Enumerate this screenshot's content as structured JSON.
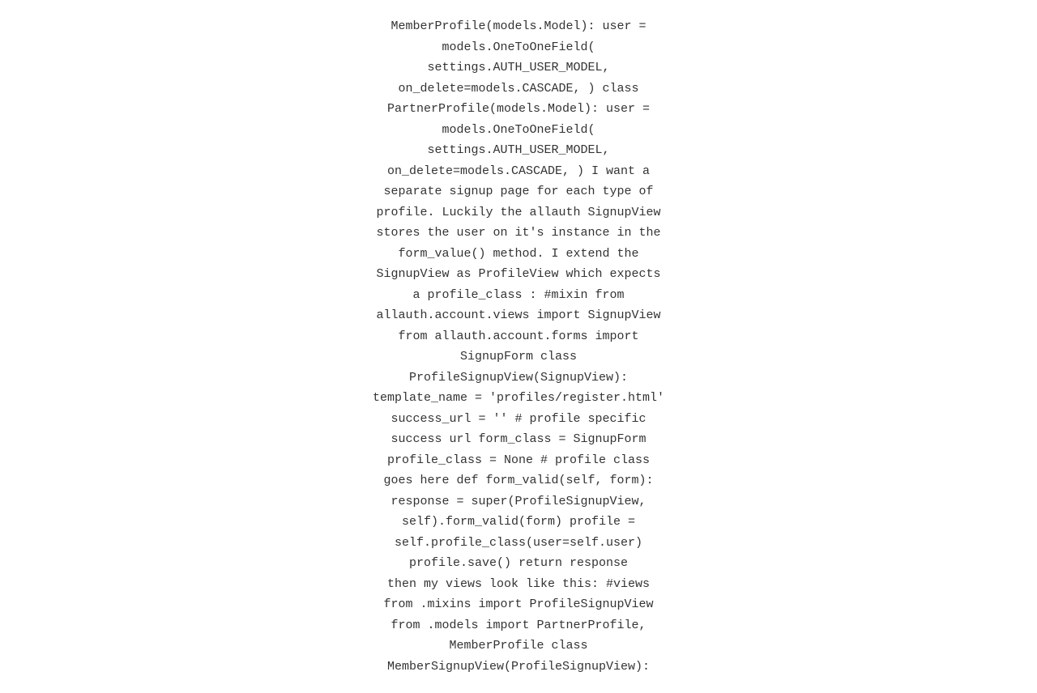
{
  "content": {
    "lines": [
      {
        "type": "code",
        "text": "MemberProfile(models.Model):   user ="
      },
      {
        "type": "code",
        "text": "models.OneToOneField("
      },
      {
        "type": "code",
        "text": "settings.AUTH_USER_MODEL,"
      },
      {
        "type": "code",
        "text": "on_delete=models.CASCADE,  )   class"
      },
      {
        "type": "code",
        "text": "PartnerProfile(models.Model):   user ="
      },
      {
        "type": "code",
        "text": "models.OneToOneField("
      },
      {
        "type": "code",
        "text": "settings.AUTH_USER_MODEL,"
      },
      {
        "type": "code",
        "text": "on_delete=models.CASCADE,  )  I want a"
      },
      {
        "type": "prose",
        "text": "separate signup page for each type of"
      },
      {
        "type": "prose",
        "text": "profile. Luckily the allauth SignupView"
      },
      {
        "type": "prose",
        "text": "stores the user on it's instance in the"
      },
      {
        "type": "code",
        "text": "form_value()"
      },
      {
        "type": "prose",
        "text": "method. I extend the"
      },
      {
        "type": "prose",
        "text": "SignupView as ProfileView which expects"
      },
      {
        "type": "code",
        "text": "a profile_class :"
      },
      {
        "type": "code",
        "text": "#mixin  from"
      },
      {
        "type": "code",
        "text": "allauth.account.views import SignupView"
      },
      {
        "type": "code",
        "text": "from allauth.account.forms import"
      },
      {
        "type": "code",
        "text": "SignupForm   class"
      },
      {
        "type": "code",
        "text": "ProfileSignupView(SignupView):"
      },
      {
        "type": "code",
        "text": "template_name = 'profiles/register.html'"
      },
      {
        "type": "code",
        "text": "success_url = ''  # profile specific"
      },
      {
        "type": "code",
        "text": "success url   form_class = SignupForm"
      },
      {
        "type": "code",
        "text": "profile_class = None  # profile class"
      },
      {
        "type": "code",
        "text": "goes here    def form_valid(self, form):"
      },
      {
        "type": "code",
        "text": "response = super(ProfileSignupView,"
      },
      {
        "type": "code",
        "text": "self).form_valid(form)     profile ="
      },
      {
        "type": "code",
        "text": "self.profile_class(user=self.user)"
      },
      {
        "type": "code",
        "text": "profile.save()      return response"
      },
      {
        "type": "code",
        "text": "then my views look like this: #views"
      },
      {
        "type": "code",
        "text": "from .mixins import ProfileSignupView"
      },
      {
        "type": "code",
        "text": "from .models import PartnerProfile,"
      },
      {
        "type": "code",
        "text": "MemberProfile  class"
      },
      {
        "type": "code",
        "text": "MemberSignupView(ProfileSignupView):"
      }
    ]
  }
}
